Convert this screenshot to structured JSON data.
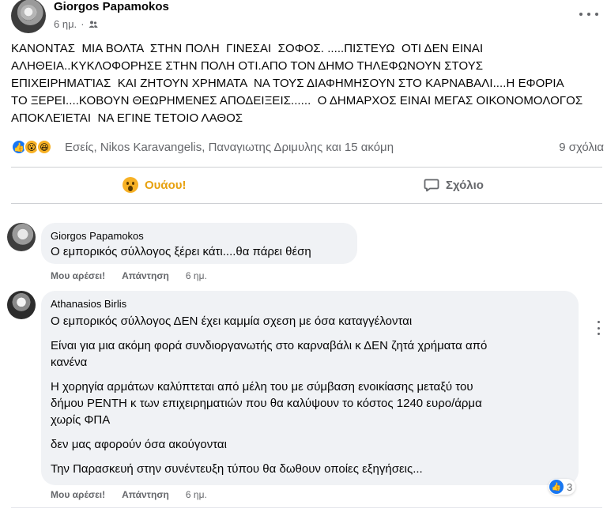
{
  "post": {
    "author": "Giorgos Papamokos",
    "time": "6 ημ.",
    "text": "ΚΑΝΟΝΤΑΣ  ΜΙΑ ΒΟΛΤΑ  ΣΤΗΝ ΠΟΛΗ  ΓΙΝΕΣΑΙ  ΣΟΦΟΣ. .....ΠΙΣΤΕΥΩ  ΟΤΙ ΔΕΝ ΕΙΝΑΙ\nΑΛΗΘΕΙΑ..ΚΥΚΛΟΦΟΡΗΣΕ ΣΤΗΝ ΠΟΛΗ ΟΤΙ.ΑΠΟ ΤΟΝ ΔΗΜΟ ΤΗΛΕΦΩΝΟΥΝ ΣΤΟΥΣ\nΕΠΙΧΕΙΡΗΜΑΤΊΑΣ  ΚΑΙ ΖΗΤΟΥΝ ΧΡΗΜΑΤΑ  ΝΑ ΤΟΥΣ ΔΙΑΦΗΜΗΣΟΥΝ ΣΤΟ ΚΑΡΝΑΒΑΛΙ....Η ΕΦΟΡΙΑ\nΤΟ ΞΕΡΕΙ....ΚΟΒΟΥΝ ΘΕΩΡΗΜΕΝΕΣ ΑΠΟΔΕΙΞΕΙΣ......  Ο ΔΗΜΑΡΧΟΣ ΕΙΝΑΙ ΜΕΓΑΣ ΟΙΚΟΝΟΜΟΛΟΓΟΣ\nΑΠΟΚΛΕΊΕΤΑΙ  ΝΑ ΕΓΙΝΕ ΤΕΤΟΙΟ ΛΑΘΟΣ"
  },
  "reactions": {
    "names": "Εσείς, Nikos Karavangelis, Παναγιωτης Δριμυλης και 15 ακόμη",
    "comment_count": "9 σχόλια"
  },
  "actions": {
    "wow_label": "Ουάου!",
    "comment_label": "Σχόλιο"
  },
  "comments": [
    {
      "author": "Giorgos Papamokos",
      "text": "Ο εμπορικός σύλλογος ξέρει κάτι....θα πάρει θέση",
      "like_label": "Μου αρέσει!",
      "reply_label": "Απάντηση",
      "time": "6 ημ."
    },
    {
      "author": "Athanasios Birlis",
      "paragraphs": [
        "Ο εμπορικός σύλλογος ΔΕΝ έχει καμμία σχεση με όσα καταγγέλονται",
        "Είναι για μια ακόμη φορά συνδιοργανωτής στο καρναβάλι κ ΔΕΝ ζητά χρήματα από\nκανένα",
        "Η χορηγία αρμάτων καλύπτεται από μέλη του με σύμβαση ενοικίασης μεταξύ του\nδήμου ΡΕΝΤΗ κ των επιχειρηματιών που θα καλύψουν το κόστος 1240 ευρο/άρμα\nχωρίς ΦΠΑ",
        "δεν μας αφορούν όσα ακούγονται",
        "Την Παρασκευή στην συνέντευξη τύπου θα δωθουν οποίες εξηγήσεις..."
      ],
      "like_label": "Μου αρέσει!",
      "reply_label": "Απάντηση",
      "time": "6 ημ.",
      "reaction_count": "3"
    }
  ],
  "colors": {
    "wow_accent": "#e7a10f",
    "like_blue": "#1877f2",
    "secondary_text": "#65676b",
    "bubble_bg": "#f0f2f5"
  }
}
